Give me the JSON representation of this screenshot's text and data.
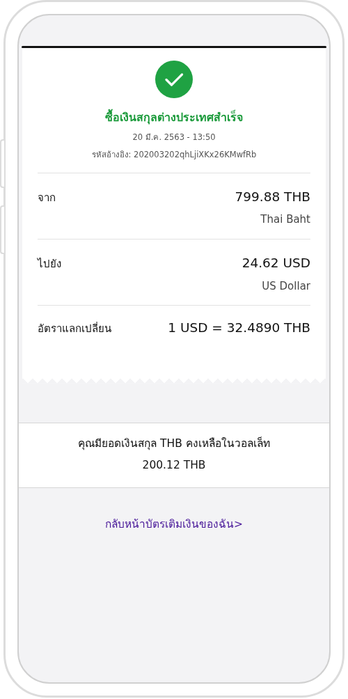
{
  "receipt": {
    "title": "ซื้อเงินสกุลต่างประเทศสำเร็จ",
    "datetime": "20 มี.ค. 2563 - 13:50",
    "reference": "รหัสอ้างอิง: 202003202qhLjiXKx26KMwfRb",
    "rows": [
      {
        "label": "จาก",
        "value": "799.88 THB",
        "subvalue": "Thai Baht"
      },
      {
        "label": "ไปยัง",
        "value": "24.62 USD",
        "subvalue": "US Dollar"
      },
      {
        "label": "อัตราแลกเปลี่ยน",
        "value": "1 USD = 32.4890 THB"
      }
    ]
  },
  "balance": {
    "message": "คุณมียอดเงินสกุล THB คงเหลือในวอลเล็ท",
    "amount": "200.12 THB"
  },
  "link": {
    "label": "กลับหน้าบัตรเติมเงินของฉัน>"
  }
}
